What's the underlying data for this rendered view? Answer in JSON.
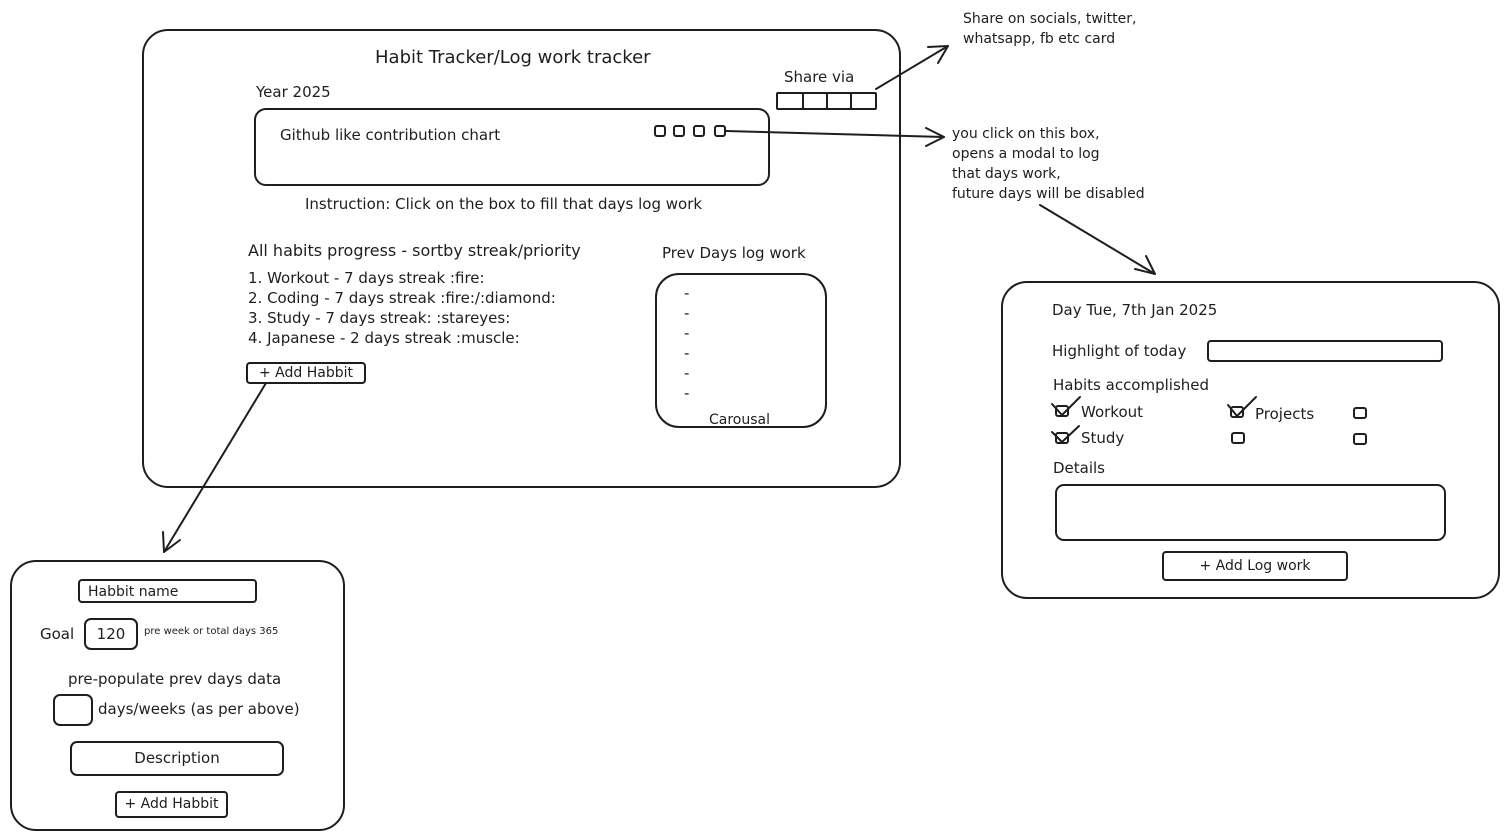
{
  "main_card": {
    "title": "Habit Tracker/Log work tracker",
    "year": "Year 2025",
    "share_label": "Share via",
    "chart_label": "Github like contribution chart",
    "instruction": "Instruction: Click on the box to fill that days log work",
    "habits_heading": "All habits progress - sortby streak/priority",
    "habits": [
      "1. Workout - 7 days streak :fire:",
      "2. Coding - 7 days streak :fire:/:diamond:",
      "3. Study - 7 days streak: :stareyes:",
      "4. Japanese - 2 days streak :muscle:"
    ],
    "add_habit_button": "+ Add Habbit",
    "prev_days_heading": "Prev Days log work",
    "prev_days_items": [
      "-",
      "-",
      "-",
      "-",
      "-",
      "-"
    ],
    "carousel_label": "Carousal"
  },
  "annotations": {
    "share_note_line1": "Share on socials, twitter,",
    "share_note_line2": "whatsapp, fb etc card",
    "box_note_line1": "you click on this box,",
    "box_note_line2": "opens a modal to log",
    "box_note_line3": "that days work,",
    "box_note_line4": "future days will be disabled"
  },
  "add_habit_form": {
    "name_placeholder": "Habbit name",
    "goal_label": "Goal",
    "goal_value": "120",
    "goal_hint": "pre week or total days 365",
    "prepopulate_label": "pre-populate prev days data",
    "days_label": "days/weeks (as per above)",
    "description_placeholder": "Description",
    "submit_button": "+ Add Habbit"
  },
  "log_modal": {
    "day_label": "Day Tue, 7th Jan 2025",
    "highlight_label": "Highlight of today",
    "habits_label": "Habits accomplished",
    "habit_workout": "Workout",
    "habit_projects": "Projects",
    "habit_study": "Study",
    "details_label": "Details",
    "submit_button": "+ Add Log work"
  }
}
